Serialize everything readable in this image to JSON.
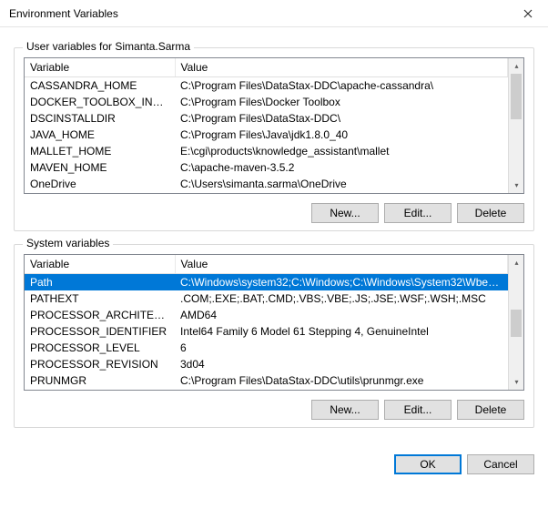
{
  "titlebar": {
    "title": "Environment Variables"
  },
  "user_group": {
    "label": "User variables for Simanta.Sarma",
    "headers": {
      "variable": "Variable",
      "value": "Value"
    },
    "rows": [
      {
        "variable": "CASSANDRA_HOME",
        "value": "C:\\Program Files\\DataStax-DDC\\apache-cassandra\\"
      },
      {
        "variable": "DOCKER_TOOLBOX_INSTAL...",
        "value": "C:\\Program Files\\Docker Toolbox"
      },
      {
        "variable": "DSCINSTALLDIR",
        "value": "C:\\Program Files\\DataStax-DDC\\"
      },
      {
        "variable": "JAVA_HOME",
        "value": "C:\\Program Files\\Java\\jdk1.8.0_40"
      },
      {
        "variable": "MALLET_HOME",
        "value": "E:\\cgi\\products\\knowledge_assistant\\mallet"
      },
      {
        "variable": "MAVEN_HOME",
        "value": "C:\\apache-maven-3.5.2"
      },
      {
        "variable": "OneDrive",
        "value": "C:\\Users\\simanta.sarma\\OneDrive"
      }
    ],
    "buttons": {
      "new": "New...",
      "edit": "Edit...",
      "delete": "Delete"
    }
  },
  "system_group": {
    "label": "System variables",
    "headers": {
      "variable": "Variable",
      "value": "Value"
    },
    "rows": [
      {
        "variable": "Path",
        "value": "C:\\Windows\\system32;C:\\Windows;C:\\Windows\\System32\\Wbem;...",
        "selected": true
      },
      {
        "variable": "PATHEXT",
        "value": ".COM;.EXE;.BAT;.CMD;.VBS;.VBE;.JS;.JSE;.WSF;.WSH;.MSC"
      },
      {
        "variable": "PROCESSOR_ARCHITECTURE",
        "value": "AMD64"
      },
      {
        "variable": "PROCESSOR_IDENTIFIER",
        "value": "Intel64 Family 6 Model 61 Stepping 4, GenuineIntel"
      },
      {
        "variable": "PROCESSOR_LEVEL",
        "value": "6"
      },
      {
        "variable": "PROCESSOR_REVISION",
        "value": "3d04"
      },
      {
        "variable": "PRUNMGR",
        "value": "C:\\Program Files\\DataStax-DDC\\utils\\prunmgr.exe"
      }
    ],
    "buttons": {
      "new": "New...",
      "edit": "Edit...",
      "delete": "Delete"
    }
  },
  "dialog_buttons": {
    "ok": "OK",
    "cancel": "Cancel"
  }
}
